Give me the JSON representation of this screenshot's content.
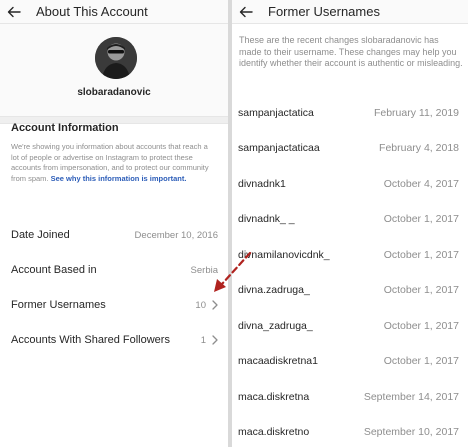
{
  "left_screen": {
    "header": {
      "title": "About This Account"
    },
    "profile": {
      "username": "slobaradanovic"
    },
    "account_information": {
      "title": "Account Information",
      "description": "We're showing you information about accounts that reach a lot of people or advertise on Instagram to protect these accounts from impersonation, and to protect our community from spam.",
      "link": "See why this information is important."
    },
    "rows": [
      {
        "label": "Date Joined",
        "value": "December 10, 2016",
        "chevron": false
      },
      {
        "label": "Account Based in",
        "value": "Serbia",
        "chevron": false
      },
      {
        "label": "Former Usernames",
        "value": "10",
        "chevron": true
      },
      {
        "label": "Accounts With Shared Followers",
        "value": "1",
        "chevron": true
      }
    ]
  },
  "right_screen": {
    "header": {
      "title": "Former Usernames"
    },
    "description": "These are the recent changes slobaradanovic has made to their username. These changes may help you identify whether their account is authentic or misleading.",
    "entries": [
      {
        "username": "sampanjactatica",
        "date": "February 11, 2019"
      },
      {
        "username": "sampanjactaticaa",
        "date": "February 4, 2018"
      },
      {
        "username": "divnadnk1",
        "date": "October 4, 2017"
      },
      {
        "username": "divnadnk_ _",
        "date": "October 1, 2017"
      },
      {
        "username": "divnamilanovicdnk_",
        "date": "October 1, 2017"
      },
      {
        "username": "divna.zadruga_",
        "date": "October 1, 2017"
      },
      {
        "username": "divna_zadruga_",
        "date": "October 1, 2017"
      },
      {
        "username": "macaadiskretna1",
        "date": "October 1, 2017"
      },
      {
        "username": "maca.diskretna",
        "date": "September 14, 2017"
      },
      {
        "username": "maca.diskretno",
        "date": "September 10, 2017"
      }
    ]
  },
  "colors": {
    "annotation_arrow": "#b0231f",
    "link": "#2c5db8",
    "muted_text": "#8e8e8e"
  },
  "icons": [
    "back-arrow-icon",
    "chevron-right-icon"
  ]
}
